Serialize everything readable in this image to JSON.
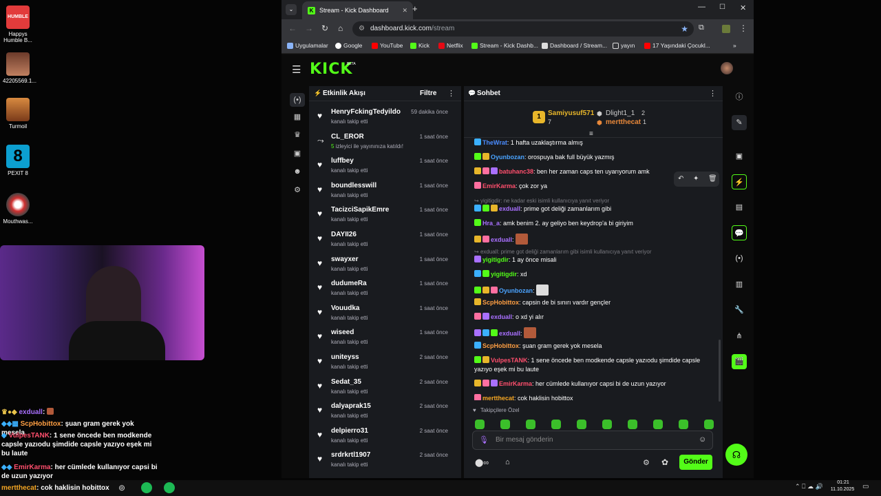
{
  "desktop": {
    "icons": [
      {
        "label": "Happys Humble B..."
      },
      {
        "label": "42205569.1..."
      },
      {
        "label": "Turmoil"
      },
      {
        "label": "PEXIT 8"
      },
      {
        "label": "Mouthwas..."
      }
    ],
    "happy_logo_text": "HUMBLE"
  },
  "overlay_chat": [
    {
      "user": "exduall",
      "text": ":",
      "color": "#a970ff"
    },
    {
      "user": "ScpHobittox",
      "text": ": şuan gram gerek yok mesela",
      "color": "#ff9f43"
    },
    {
      "user": "VulpesTANK",
      "text": ": 1 sene öncede ben modkende capsle yazıodu şimdide capsle yazıyo eşek mi bu laute",
      "color": "#ff4f6d"
    },
    {
      "user": "EmirKarma",
      "text": ": her cümlede kullanıyor capsi bi de uzun yazıyor",
      "color": "#ff4f6d"
    },
    {
      "user": "mertthecat",
      "text": ": cok haklisin hobittox",
      "color": "#f5a623"
    }
  ],
  "browser": {
    "tab_title": "Stream - Kick Dashboard",
    "url_host": "dashboard.kick.com",
    "url_path": "/stream",
    "bookmarks": [
      "Uygulamalar",
      "Google",
      "YouTube",
      "Kick",
      "Netflix",
      "Stream - Kick Dashb...",
      "Dashboard / Stream...",
      "yayın",
      "17 Yaşındaki Çocukl..."
    ],
    "bookmark_overflow": "»"
  },
  "app": {
    "logo": "KICK",
    "logo_beta": "BETA"
  },
  "activity": {
    "title": "Etkinlik Akışı",
    "filter": "Filtre",
    "items": [
      {
        "name": "HenryFckingTedyildo",
        "sub": "kanalı takip etti",
        "time": "59 dakika önce"
      },
      {
        "name": "CL_EROR",
        "sub": "izleyici ile yayınınıza katıldı!",
        "count": "5",
        "time": "1 saat önce"
      },
      {
        "name": "luffbey",
        "sub": "kanalı takip etti",
        "time": "1 saat önce"
      },
      {
        "name": "boundlesswill",
        "sub": "kanalı takip etti",
        "time": "1 saat önce"
      },
      {
        "name": "TacizciSapikEmre",
        "sub": "kanalı takip etti",
        "time": "1 saat önce"
      },
      {
        "name": "DAYII26",
        "sub": "kanalı takip etti",
        "time": "1 saat önce"
      },
      {
        "name": "swayxer",
        "sub": "kanalı takip etti",
        "time": "1 saat önce"
      },
      {
        "name": "dudumeRa",
        "sub": "kanalı takip etti",
        "time": "1 saat önce"
      },
      {
        "name": "Vouudka",
        "sub": "kanalı takip etti",
        "time": "1 saat önce"
      },
      {
        "name": "wiseed",
        "sub": "kanalı takip etti",
        "time": "1 saat önce"
      },
      {
        "name": "uniteyss",
        "sub": "kanalı takip etti",
        "time": "2 saat önce"
      },
      {
        "name": "Sedat_35",
        "sub": "kanalı takip etti",
        "time": "2 saat önce"
      },
      {
        "name": "dalyaprak15",
        "sub": "kanalı takip etti",
        "time": "2 saat önce"
      },
      {
        "name": "delpierro31",
        "sub": "kanalı takip etti",
        "time": "2 saat önce"
      },
      {
        "name": "srdrkrtl1907",
        "sub": "kanalı takip etti",
        "time": "2 saat önce"
      }
    ]
  },
  "chat": {
    "title": "Sohbet",
    "leaderboard": {
      "first": {
        "rank": "1",
        "name": "Samiyusuf571",
        "count": "7"
      },
      "second": {
        "name": "Dlight1_1",
        "count": "2"
      },
      "third": {
        "name": "mertthecat",
        "count": "1"
      }
    },
    "messages": [
      {
        "user": "TheWrat",
        "text": ": 1 hafta uzaklaştırma almış",
        "color": "#4a8cff"
      },
      {
        "user": "Oyunbozan",
        "text": ": orospuya bak full büyük yazmış",
        "color": "#4aa3ff"
      },
      {
        "user": "batuhanc38",
        "text": ": ben her zaman caps ten uyarıyorum amk",
        "color": "#ff4f6d"
      },
      {
        "user": "EmirKarma",
        "text": ": çok zor ya",
        "color": "#ff4f6d"
      },
      {
        "reply": "yigitigdir: ne kadar eski isimli kullanıcıya yanıt veriyor"
      },
      {
        "user": "exduall",
        "text": ": prime got deliği zamanlarım gibi",
        "color": "#a970ff"
      },
      {
        "user": "Hra_a",
        "text": ": amk benim 2. ay geliyo ben keydrop'a bi giriyim",
        "color": "#a970ff"
      },
      {
        "user": "exduall",
        "text": ":",
        "color": "#a970ff"
      },
      {
        "reply": "exduall: prime got deliği zamanlarım gibi isimli kullanıcıya yanıt veriyor"
      },
      {
        "user": "yigitigdir",
        "text": ": 1 ay önce misali",
        "color": "#53fc18"
      },
      {
        "user": "yigitigdir",
        "text": ": xd",
        "color": "#53fc18"
      },
      {
        "user": "Oyunbozan",
        "text": ":",
        "color": "#4aa3ff"
      },
      {
        "user": "ScpHobittox",
        "text": ": capsin de bi sınırı vardır gençler",
        "color": "#ff9f43"
      },
      {
        "user": "exduall",
        "text": ": o xd yi alır",
        "color": "#a970ff"
      },
      {
        "user": "exduall",
        "text": ":",
        "color": "#a970ff"
      },
      {
        "user": "ScpHobittox",
        "text": ": şuan gram gerek yok mesela",
        "color": "#ff9f43"
      },
      {
        "user": "VulpesTANK",
        "text": ": 1 sene öncede ben modkende capsle yazıodu şimdide capsle",
        "text2": "yazıyo eşek mi bu laute",
        "color": "#ff4f6d"
      },
      {
        "user": "EmirKarma",
        "text": ": her cümlede kullanıyor capsi bi de uzun yazıyor",
        "color": "#ff4f6d"
      },
      {
        "user": "mertthecat",
        "text": ": cok haklisin hobittox",
        "color": "#f5a623"
      }
    ],
    "emote_section": "Takipçilere Özel",
    "input_placeholder": "Bir mesaj gönderin",
    "send": "Gönder"
  },
  "taskbar": {
    "time": "01:21",
    "date": "11.10.2025"
  }
}
